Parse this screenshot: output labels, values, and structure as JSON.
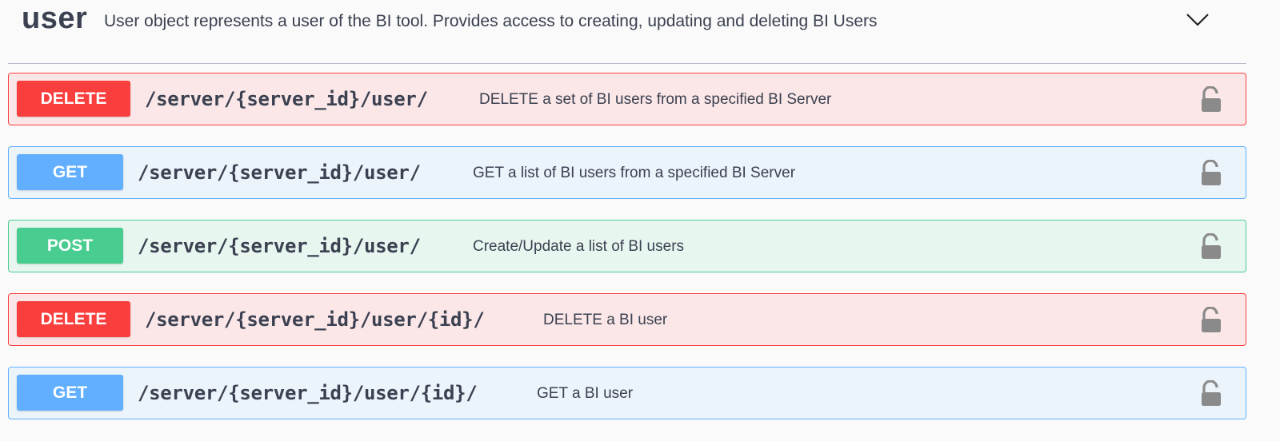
{
  "tag": {
    "name": "user",
    "description": "User object represents a user of the BI tool. Provides access to creating, updating and deleting BI Users"
  },
  "operations": [
    {
      "method": "DELETE",
      "path": "/server/{server_id}/user/",
      "summary": "DELETE a set of BI users from a specified BI Server"
    },
    {
      "method": "GET",
      "path": "/server/{server_id}/user/",
      "summary": "GET a list of BI users from a specified BI Server"
    },
    {
      "method": "POST",
      "path": "/server/{server_id}/user/",
      "summary": "Create/Update a list of BI users"
    },
    {
      "method": "DELETE",
      "path": "/server/{server_id}/user/{id}/",
      "summary": "DELETE a BI user"
    },
    {
      "method": "GET",
      "path": "/server/{server_id}/user/{id}/",
      "summary": "GET a BI user"
    }
  ],
  "icons": {
    "collapse": "chevron-down-icon",
    "auth": "unlocked-lock-icon"
  },
  "colors": {
    "delete": "#f93e3e",
    "get": "#61affe",
    "post": "#49cc90",
    "text": "#3b4151",
    "lock": "#8a8a8a"
  }
}
